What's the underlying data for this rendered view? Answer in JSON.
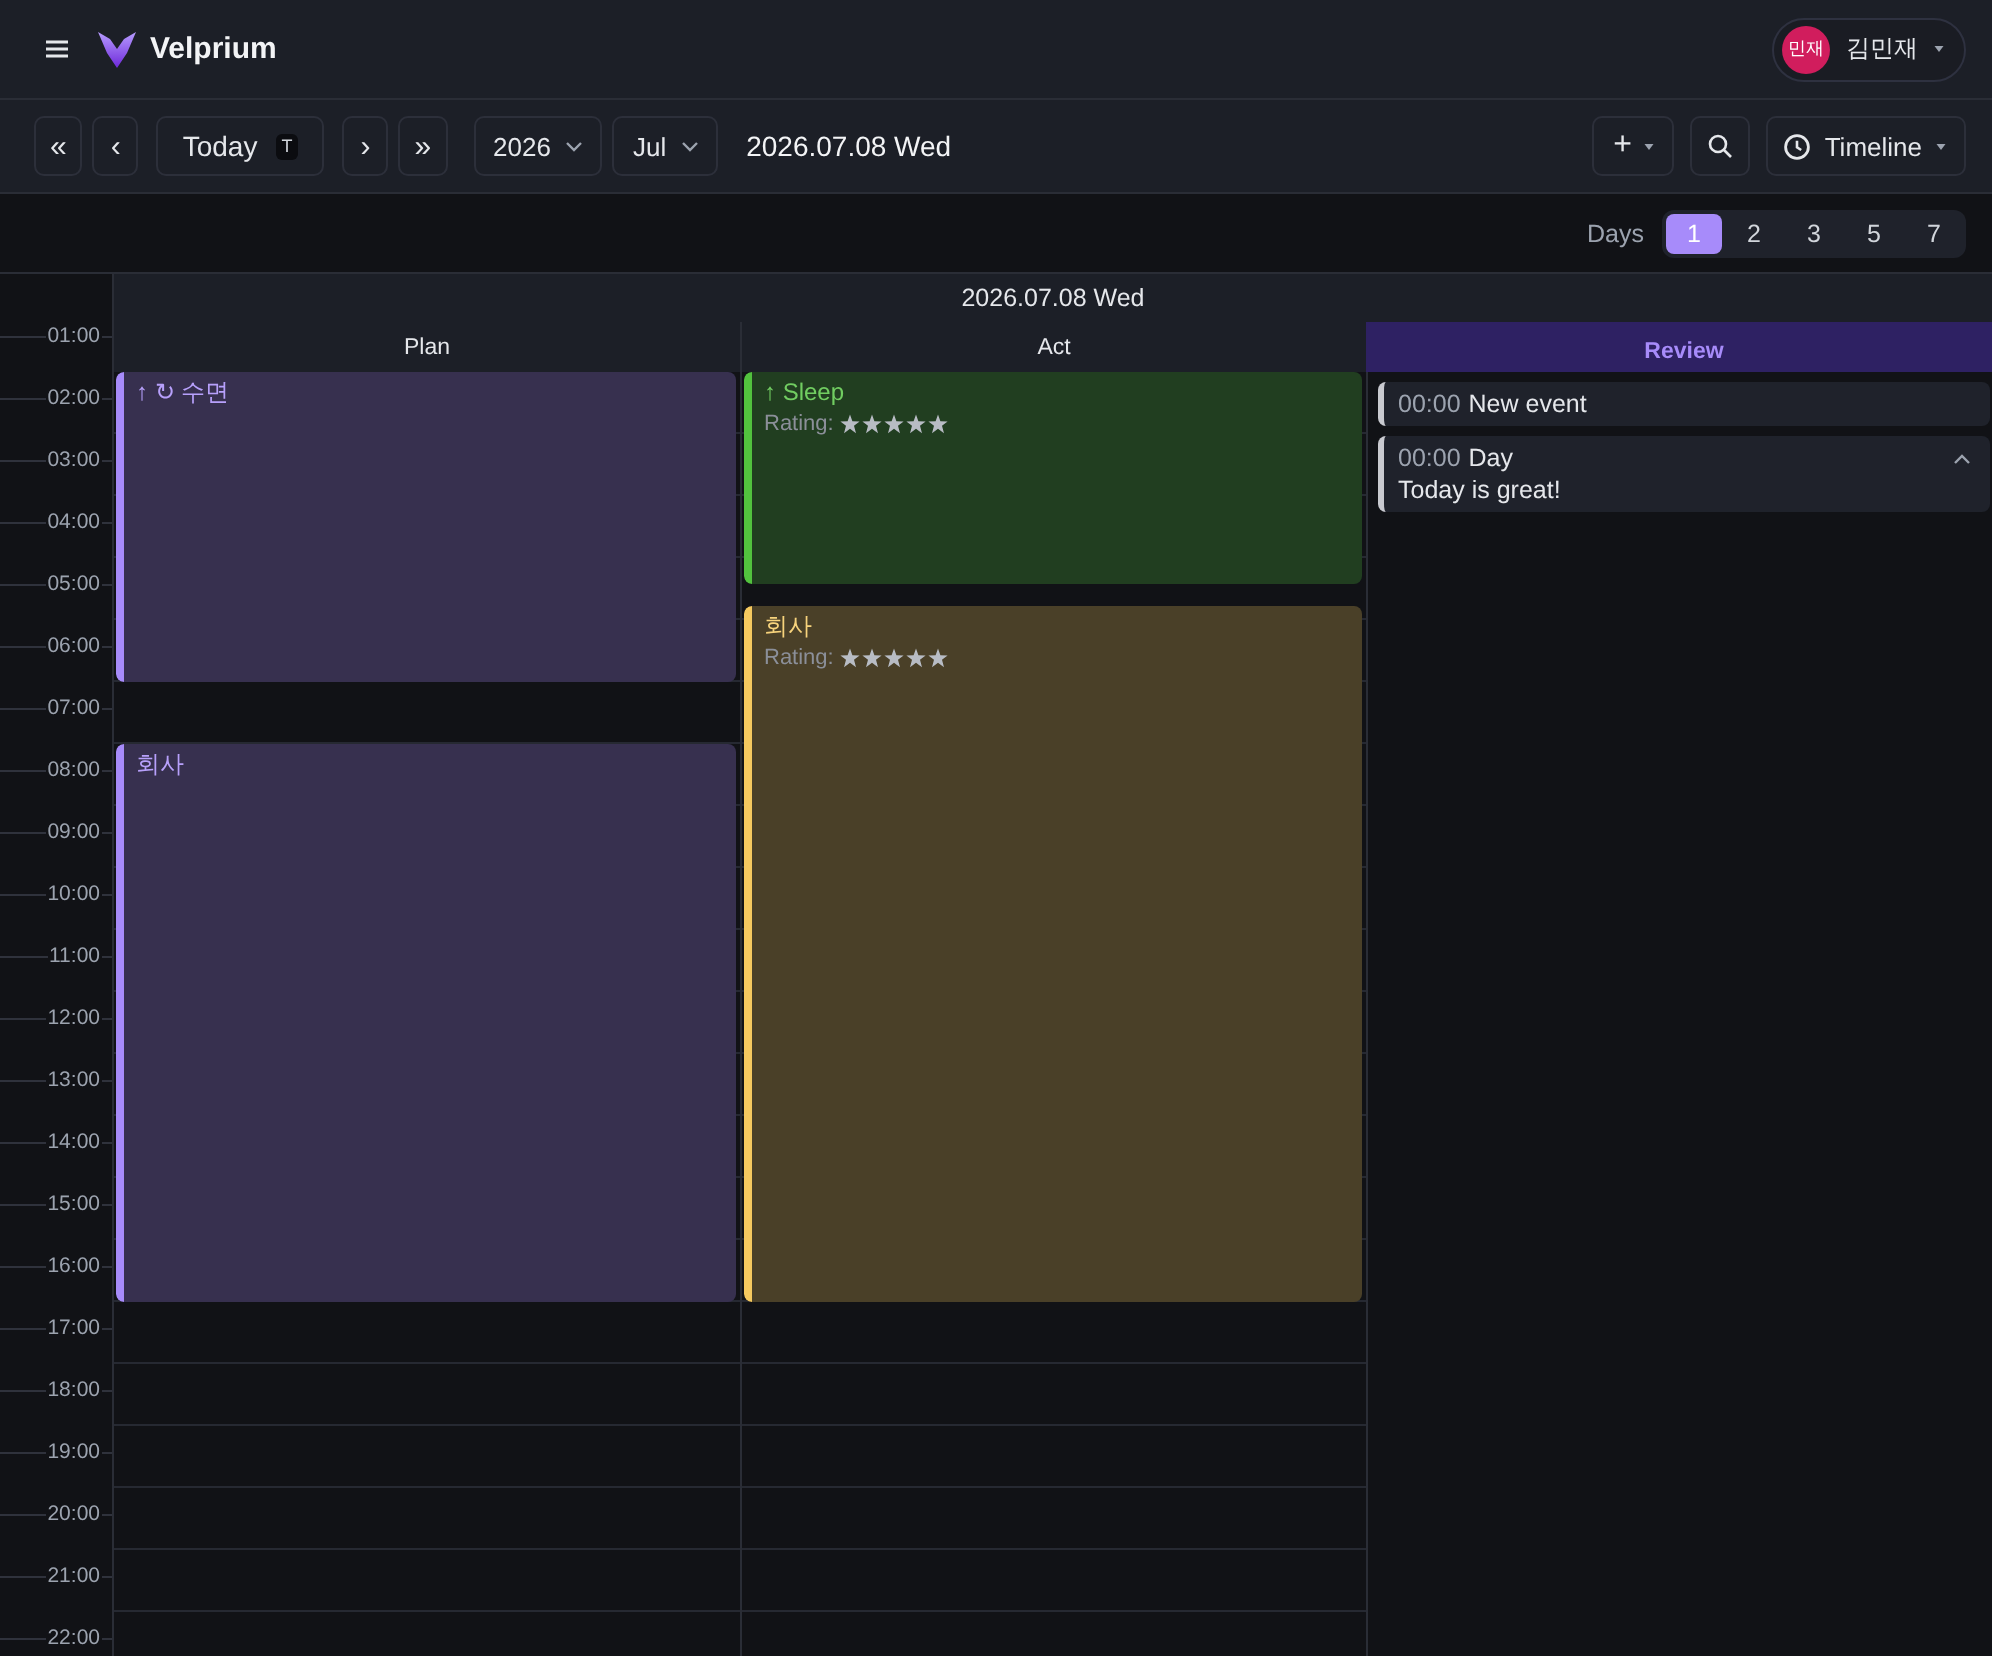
{
  "header": {
    "app_name": "Velprium",
    "user": {
      "initials": "민재",
      "name": "김민재"
    }
  },
  "toolbar": {
    "controls": [
      {
        "kind": "nav",
        "label": "«"
      },
      {
        "kind": "nav",
        "label": "‹"
      },
      {
        "kind": "today",
        "label": "Today",
        "shortcut": "T"
      },
      {
        "kind": "nav",
        "label": "›"
      },
      {
        "kind": "nav",
        "label": "»"
      },
      {
        "kind": "select",
        "label": "2026"
      },
      {
        "kind": "select",
        "label": "Jul"
      }
    ],
    "date": "2026.07.08 Wed",
    "actions": [
      {
        "kind": "add",
        "label": "+"
      },
      {
        "kind": "search"
      },
      {
        "kind": "view",
        "label": "Timeline"
      }
    ]
  },
  "days": {
    "label": "Days",
    "options": [
      {
        "label": "1",
        "selected": true
      },
      {
        "label": "2",
        "selected": false
      },
      {
        "label": "3",
        "selected": false
      },
      {
        "label": "5",
        "selected": false
      },
      {
        "label": "7",
        "selected": false
      }
    ]
  },
  "calendar": {
    "date": "2026.07.08 Wed",
    "hours": [
      "01:00",
      "02:00",
      "03:00",
      "04:00",
      "05:00",
      "06:00",
      "07:00",
      "08:00",
      "09:00",
      "10:00",
      "11:00",
      "12:00",
      "13:00",
      "14:00",
      "15:00",
      "16:00",
      "17:00",
      "18:00",
      "19:00",
      "20:00",
      "21:00",
      "22:00"
    ],
    "columns": [
      {
        "title": "Plan",
        "kind": "timeline",
        "events": [
          {
            "markers": [
              "↑",
              "↻"
            ],
            "title": "수면",
            "color": "#a78bfa"
          },
          {
            "title": "회사",
            "color": "#a78bfa"
          }
        ]
      },
      {
        "title": "Act",
        "kind": "timeline",
        "events": [
          {
            "markers": [
              "↑"
            ],
            "title": "Sleep",
            "rating_label": "Rating:",
            "stars": 5,
            "color": "#52c23e"
          },
          {
            "title": "회사",
            "rating_label": "Rating:",
            "stars": 5,
            "color": "#f5c95f"
          }
        ]
      },
      {
        "title": "Review",
        "kind": "list",
        "items": [
          {
            "time": "00:00",
            "title": "New event"
          },
          {
            "time": "00:00",
            "title": "Day",
            "note": "Today is great!",
            "expanded": true
          }
        ]
      }
    ]
  }
}
